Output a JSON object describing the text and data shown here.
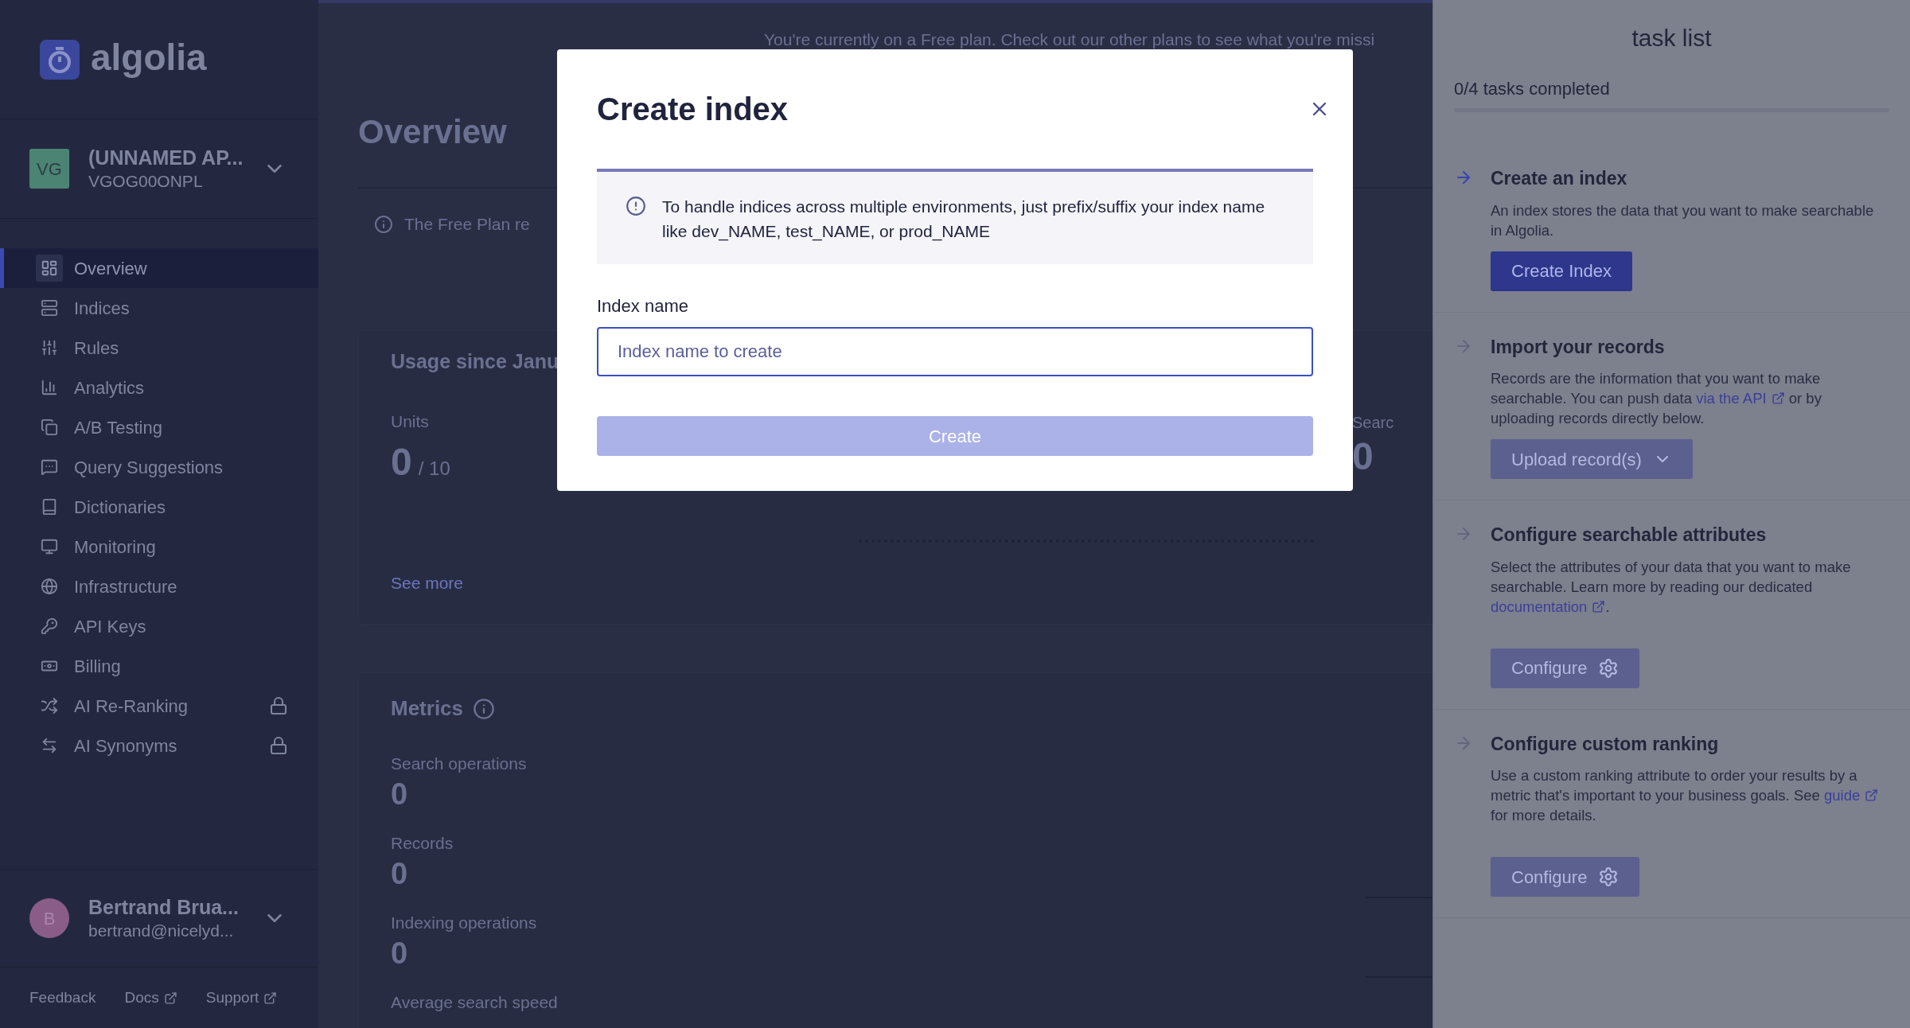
{
  "sidebar": {
    "logo": "algolia",
    "account": {
      "initials": "VG",
      "name": "(UNNAMED AP...",
      "id": "VGOG00ONPL"
    },
    "nav": [
      {
        "label": "Overview",
        "selected": true,
        "locked": false
      },
      {
        "label": "Indices",
        "selected": false,
        "locked": false
      },
      {
        "label": "Rules",
        "selected": false,
        "locked": false
      },
      {
        "label": "Analytics",
        "selected": false,
        "locked": false
      },
      {
        "label": "A/B Testing",
        "selected": false,
        "locked": false
      },
      {
        "label": "Query Suggestions",
        "selected": false,
        "locked": false
      },
      {
        "label": "Dictionaries",
        "selected": false,
        "locked": false
      },
      {
        "label": "Monitoring",
        "selected": false,
        "locked": false
      },
      {
        "label": "Infrastructure",
        "selected": false,
        "locked": false
      },
      {
        "label": "API Keys",
        "selected": false,
        "locked": false
      },
      {
        "label": "Billing",
        "selected": false,
        "locked": false
      },
      {
        "label": "AI Re-Ranking",
        "selected": false,
        "locked": true
      },
      {
        "label": "AI Synonyms",
        "selected": false,
        "locked": true
      }
    ],
    "user": {
      "initial": "B",
      "name": "Bertrand Brua...",
      "email": "bertrand@nicelyd..."
    },
    "footer": [
      {
        "label": "Feedback",
        "external": false
      },
      {
        "label": "Docs",
        "external": true
      },
      {
        "label": "Support",
        "external": true
      }
    ]
  },
  "main": {
    "banner": "You're currently on a Free plan. Check out our other plans to see what you're missi",
    "title": "Overview",
    "notice": "The Free Plan re",
    "usage": {
      "title": "Usage since Janu",
      "units_label": "Units",
      "units_value": "0",
      "units_limit": "/ 10",
      "see_more": "See more",
      "search_label": "Searc",
      "search_value": "0"
    },
    "metrics": {
      "title": "Metrics",
      "rows": [
        {
          "label": "Search operations",
          "value": "0"
        },
        {
          "label": "Records",
          "value": "0"
        },
        {
          "label": "Indexing operations",
          "value": "0"
        },
        {
          "label": "Average search speed"
        }
      ]
    }
  },
  "modal": {
    "title": "Create index",
    "info": "To handle indices across multiple environments, just prefix/suffix your index name like dev_NAME, test_NAME, or prod_NAME",
    "field_label": "Index name",
    "placeholder": "Index name to create",
    "submit": {
      "label": "Create",
      "disabled": true
    }
  },
  "task_list": {
    "title": "task list",
    "progress_text": "0/4 tasks completed",
    "level": 0,
    "tasks": [
      {
        "title": "Create an index",
        "active": true,
        "description": [
          {
            "text": "An index stores the data that you want to make searchable in Algolia."
          }
        ],
        "button": {
          "label": "Create Index",
          "kind": "plain",
          "disabled": false
        }
      },
      {
        "title": "Import your records",
        "active": false,
        "description": [
          {
            "text": "Records are the information that you want to make searchable. You can push data "
          },
          {
            "link": "via the API"
          },
          {
            "text": " or by uploading records directly below."
          }
        ],
        "button": {
          "label": "Upload record(s)",
          "kind": "dropdown",
          "disabled": true
        }
      },
      {
        "title": "Configure searchable attributes",
        "active": false,
        "description": [
          {
            "text": "Select the attributes of your data that you want to make searchable. Learn more by reading our dedicated "
          },
          {
            "link": "documentation"
          },
          {
            "text": "."
          }
        ],
        "button": {
          "label": "Configure",
          "kind": "settings",
          "disabled": true
        }
      },
      {
        "title": "Configure custom ranking",
        "active": false,
        "description": [
          {
            "text": "Use a custom ranking attribute to order your results by a metric that's important to your business goals. See "
          },
          {
            "link": "guide"
          },
          {
            "text": " for more details."
          }
        ],
        "button": {
          "label": "Configure",
          "kind": "settings",
          "disabled": true
        }
      }
    ]
  }
}
